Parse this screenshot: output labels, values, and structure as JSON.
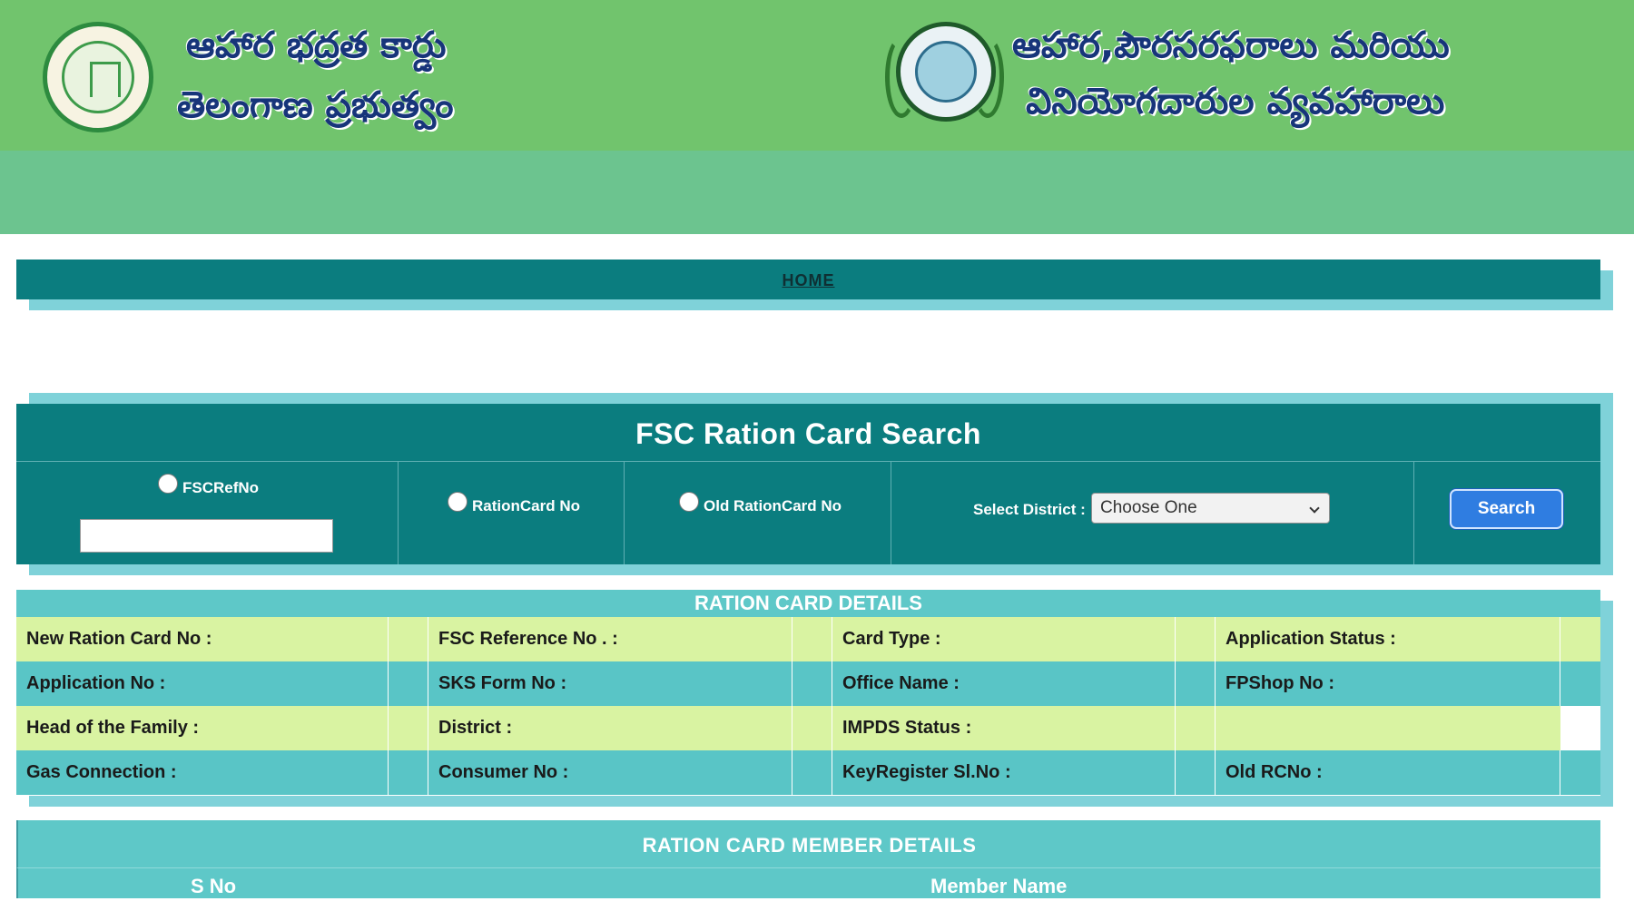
{
  "banner": {
    "left_title_line1": "ఆహార భద్రత కార్డు",
    "left_title_line2": "తెలంగాణ ప్రభుత్వం",
    "right_title_line1": "ఆహార,పౌరసరఫరాలు మరియు",
    "right_title_line2": "వినియోగదారుల వ్యవహారాలు",
    "left_emblem_icon": "telangana-govt-emblem-icon",
    "right_emblem_icon": "tscscl-logo-icon"
  },
  "nav": {
    "home_label": "HOME"
  },
  "search": {
    "title": "FSC Ration Card Search",
    "options": {
      "fsc_ref_label": "FSCRefNo",
      "ration_card_label": "RationCard No",
      "old_ration_card_label": "Old RationCard No"
    },
    "fsc_ref_value": "",
    "district_label": "Select District :",
    "district_selected": "Choose One",
    "button_label": "Search"
  },
  "details": {
    "title": "RATION CARD DETAILS",
    "rows": [
      [
        "New Ration Card No :",
        "",
        "FSC Reference No . :",
        "",
        "Card Type :",
        "",
        "Application Status :",
        ""
      ],
      [
        "Application No :",
        "",
        "SKS Form No :",
        "",
        "Office Name :",
        "",
        "FPShop No :",
        ""
      ],
      [
        "Head of the Family :",
        "",
        "District :",
        "",
        "IMPDS Status :",
        "",
        "",
        ""
      ],
      [
        "Gas Connection :",
        "",
        "Consumer No :",
        "",
        "KeyRegister Sl.No :",
        "",
        "Old RCNo :",
        ""
      ]
    ]
  },
  "members": {
    "title": "RATION CARD MEMBER DETAILS",
    "columns": [
      "S No",
      "Member Name"
    ]
  },
  "colors": {
    "banner_green": "#71c46d",
    "banner_band": "#6cc48f",
    "panel_teal": "#0b7d7f",
    "row_light": "#d9f3a2",
    "row_teal": "#59c5c6",
    "search_button": "#2f7de1",
    "title_text": "#17357a"
  }
}
